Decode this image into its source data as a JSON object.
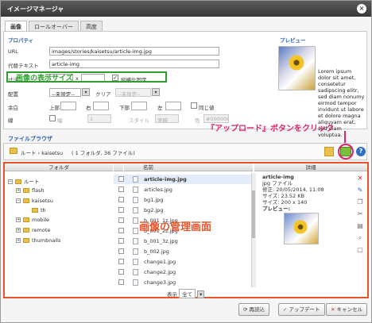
{
  "window": {
    "title": "イメージマネージャ"
  },
  "tabs": [
    "画像",
    "ロールオーバー",
    "高度"
  ],
  "properties": {
    "section_title": "プロパティ",
    "url_label": "URL",
    "url_value": "images/stories/kaisetsu/article-img.jpg",
    "alt_label": "代替テキスト",
    "alt_value": "article-img",
    "size_label": "寸法",
    "size_x": "x",
    "keep_ratio_label": "縦横比固定",
    "keep_ratio_checked": "✓",
    "align_label": "配置",
    "align_value": "--未設定--",
    "clear_label": "クリア",
    "clear_value": "--未設定--",
    "margin_label": "余白",
    "margin_top": "上部",
    "margin_right": "右",
    "margin_bottom": "下部",
    "margin_left": "左",
    "same_label": "同じ値",
    "border_label": "線",
    "border_width_label": "幅",
    "border_width_value": "1",
    "border_style_label": "スタイル",
    "border_style_value": "実線",
    "border_color_label": "色",
    "border_color_value": "#000000"
  },
  "preview": {
    "title": "プレビュー",
    "text_side": "Lorem ipsum dolor sit amet, consetetur sadipscing elitr, sed diam nonumy eirmod tempor invidunt ut labore et dolore magna aliquyam erat, sed diam voluptua.",
    "text_bottom": ""
  },
  "annotations": {
    "size_note": "画像の表示サイズ",
    "upload_note": "『アップロード』ボタンをクリック",
    "manage_note": "画像の管理画面"
  },
  "browser": {
    "title": "ファイルブラウザ",
    "breadcrumb": "ルート › kaisetsu",
    "summary": "( 1 フォルダ, 36 ファイル)"
  },
  "columns": {
    "folder": "フォルダ",
    "name": "名前",
    "details": "詳細"
  },
  "tree": [
    {
      "label": "ルート",
      "expander": "−"
    },
    {
      "label": "flash",
      "expander": "+"
    },
    {
      "label": "kaisetsu",
      "expander": "−"
    },
    {
      "label": "th",
      "expander": ""
    },
    {
      "label": "mobile",
      "expander": "+"
    },
    {
      "label": "remote",
      "expander": "+"
    },
    {
      "label": "thumbnails",
      "expander": "+"
    }
  ],
  "files": [
    "article-img.jpg",
    "articles.jpg",
    "bg1.jpg",
    "bg2.jpg",
    "b_001_1z.jpg",
    "b_001_2z.jpg",
    "b_001_3z.jpg",
    "b_002.jpg",
    "change1.jpg",
    "change2.jpg",
    "change3.jpg"
  ],
  "details": {
    "name": "article-img",
    "type": "jpg ファイル",
    "modified": "修正: 20/05/2014, 11:08",
    "size": "サイズ: 23.52 KB",
    "dims": "サイズ: 200 x 140",
    "preview_label": "プレビュー:"
  },
  "pager": {
    "label": "表示",
    "value": "全て"
  },
  "buttons": {
    "refresh": "再読込",
    "update": "アップデート",
    "cancel": "キャンセル"
  },
  "colors": {
    "annotation_green": "#2e9d2e",
    "annotation_pink": "#e0206f",
    "annotation_orange": "#e8542a"
  }
}
